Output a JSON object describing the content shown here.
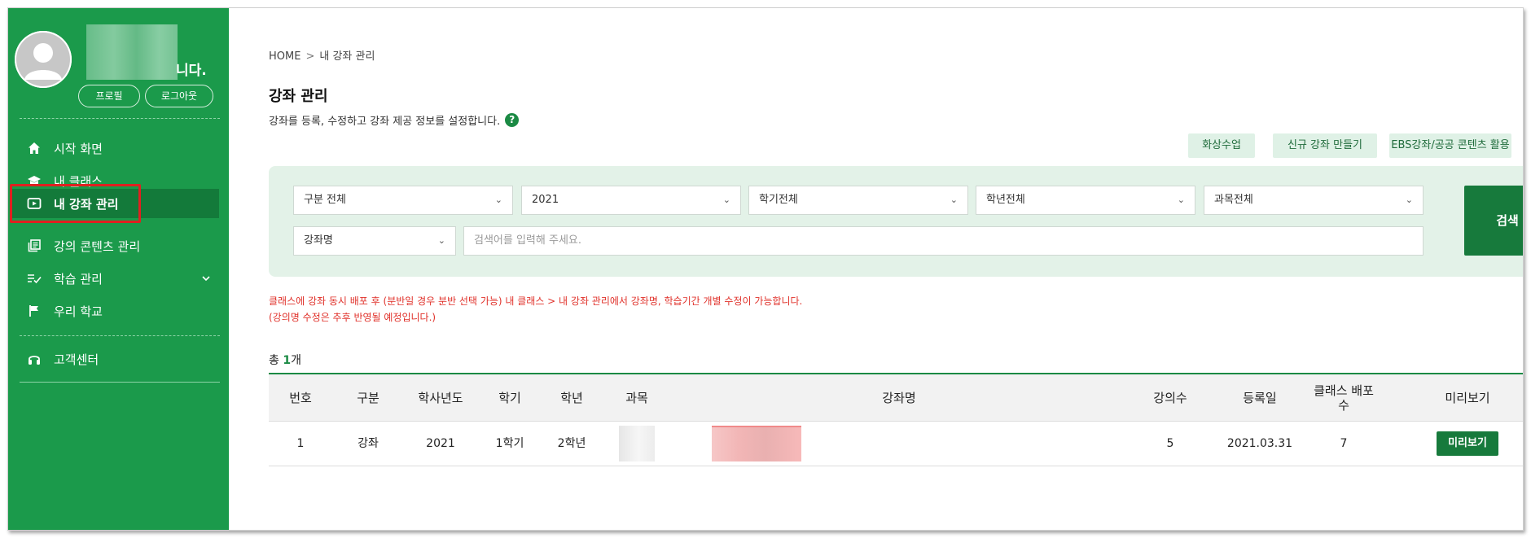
{
  "sidebar": {
    "username_suffix": "니다.",
    "profile_label": "프로필",
    "logout_label": "로그아웃",
    "items": [
      {
        "label": "시작 화면",
        "icon": "home-icon"
      },
      {
        "label": "내 클래스",
        "icon": "graduation-cap-icon"
      },
      {
        "label": "내 강좌 관리",
        "icon": "video-play-icon",
        "active": true
      },
      {
        "label": "강의 콘텐츠 관리",
        "icon": "content-stack-icon"
      },
      {
        "label": "학습 관리",
        "icon": "checklist-icon",
        "has_submenu": true
      },
      {
        "label": "우리 학교",
        "icon": "flag-icon"
      }
    ],
    "support": {
      "label": "고객센터",
      "icon": "headset-icon"
    }
  },
  "breadcrumb": {
    "home": "HOME",
    "sep": ">",
    "current": "내 강좌 관리"
  },
  "page": {
    "title": "강좌 관리",
    "description": "강좌를 등록, 수정하고 강좌 제공 정보를 설정합니다.",
    "help": "?"
  },
  "actions": {
    "video_class": "화상수업",
    "new_course": "신규 강좌 만들기",
    "ebs_content": "EBS강좌/공공 콘텐츠 활용"
  },
  "search": {
    "type": "구분 전체",
    "year": "2021",
    "semester": "학기전체",
    "grade": "학년전체",
    "subject": "과목전체",
    "field": "강좌명",
    "placeholder": "검색어를 입력해 주세요.",
    "button": "검색"
  },
  "notice": {
    "line1": "클래스에 강좌 동시 배포 후 (분반일 경우 분반 선택 가능) 내 클래스 > 내 강좌 관리에서 강좌명, 학습기간 개별 수정이 가능합니다.",
    "line2": "(강의명 수정은 추후 반영될 예정입니다.)"
  },
  "total": {
    "prefix": "총 ",
    "count": "1",
    "suffix": "개"
  },
  "table": {
    "headers": [
      "번호",
      "구분",
      "학사년도",
      "학기",
      "학년",
      "과목",
      "강좌명",
      "강의수",
      "등록일",
      "클래스 배포 수",
      "미리보기"
    ],
    "rows": [
      {
        "no": "1",
        "type": "강좌",
        "year": "2021",
        "semester": "1학기",
        "grade": "2학년",
        "lectures": "5",
        "date": "2021.03.31",
        "deploy": "7",
        "preview": "미리보기"
      }
    ]
  },
  "colors": {
    "sidebar": "#1b9a4b",
    "active": "#137a3a",
    "accent": "#177a3c",
    "notice": "#e0312a"
  }
}
